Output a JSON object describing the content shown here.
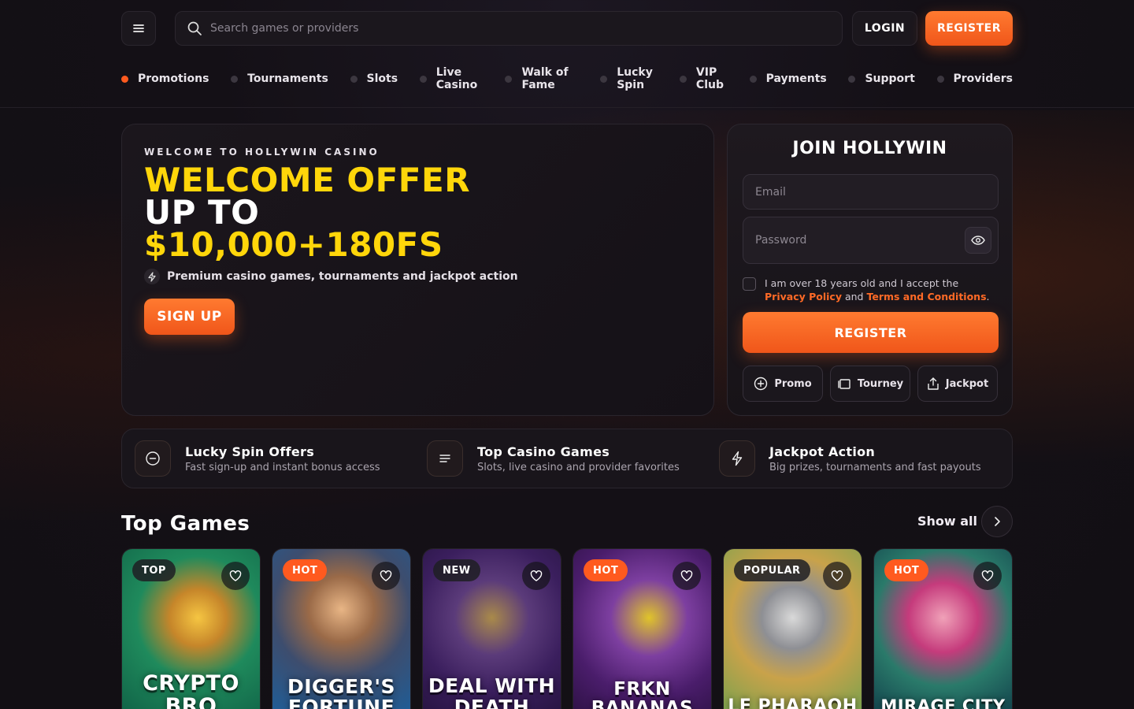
{
  "header": {
    "search_placeholder": "Search games or providers",
    "login_label": "LOGIN",
    "register_label": "REGISTER"
  },
  "nav": {
    "items": [
      {
        "label": "Promotions",
        "active": true
      },
      {
        "label": "Tournaments",
        "active": false
      },
      {
        "label": "Slots",
        "active": false
      },
      {
        "label": "Live Casino",
        "active": false
      },
      {
        "label": "Walk of Fame",
        "active": false
      },
      {
        "label": "Lucky Spin",
        "active": false
      },
      {
        "label": "VIP Club",
        "active": false
      },
      {
        "label": "Payments",
        "active": false
      },
      {
        "label": "Support",
        "active": false
      },
      {
        "label": "Providers",
        "active": false
      }
    ]
  },
  "hero": {
    "eyebrow": "WELCOME TO HOLLYWIN CASINO",
    "title_line1": "WELCOME OFFER",
    "title_line2": "UP TO",
    "title_line3": "$10,000+180FS",
    "subtitle": "Premium casino games, tournaments and jackpot action",
    "cta_label": "SIGN UP"
  },
  "join": {
    "title": "JOIN HOLLYWIN",
    "email_placeholder": "Email",
    "password_placeholder": "Password",
    "terms_prefix": "I am over 18 years old and I accept the",
    "privacy_link": "Privacy Policy",
    "terms_and": "and",
    "terms_link": "Terms and Conditions",
    "terms_suffix": ".",
    "register_label": "REGISTER",
    "quick_links": [
      {
        "label": "Promo",
        "icon": "plus-circle-icon"
      },
      {
        "label": "Tourney",
        "icon": "cards-icon"
      },
      {
        "label": "Jackpot",
        "icon": "share-up-icon"
      }
    ]
  },
  "features": [
    {
      "title": "Lucky Spin Offers",
      "subtitle": "Fast sign-up and instant bonus access",
      "icon": "minus-circle-icon"
    },
    {
      "title": "Top Casino Games",
      "subtitle": "Slots, live casino and provider favorites",
      "icon": "lines-icon"
    },
    {
      "title": "Jackpot Action",
      "subtitle": "Big prizes, tournaments and fast payouts",
      "icon": "bolt-icon"
    }
  ],
  "top_games": {
    "title": "Top Games",
    "show_all": "Show all",
    "games": [
      {
        "name": "CRYPTO BRO",
        "badge": "TOP"
      },
      {
        "name": "DIGGER'S FORTUNE",
        "badge": "HOT"
      },
      {
        "name": "DEAL WITH DEATH",
        "badge": "NEW"
      },
      {
        "name": "FRKN BANANAS",
        "badge": "HOT"
      },
      {
        "name": "LE PHARAOH",
        "badge": "POPULAR"
      },
      {
        "name": "MIRAGE CITY",
        "badge": "HOT"
      }
    ]
  },
  "colors": {
    "accent": "#ff5a1f",
    "highlight": "#ffd60a",
    "background": "#141016"
  }
}
